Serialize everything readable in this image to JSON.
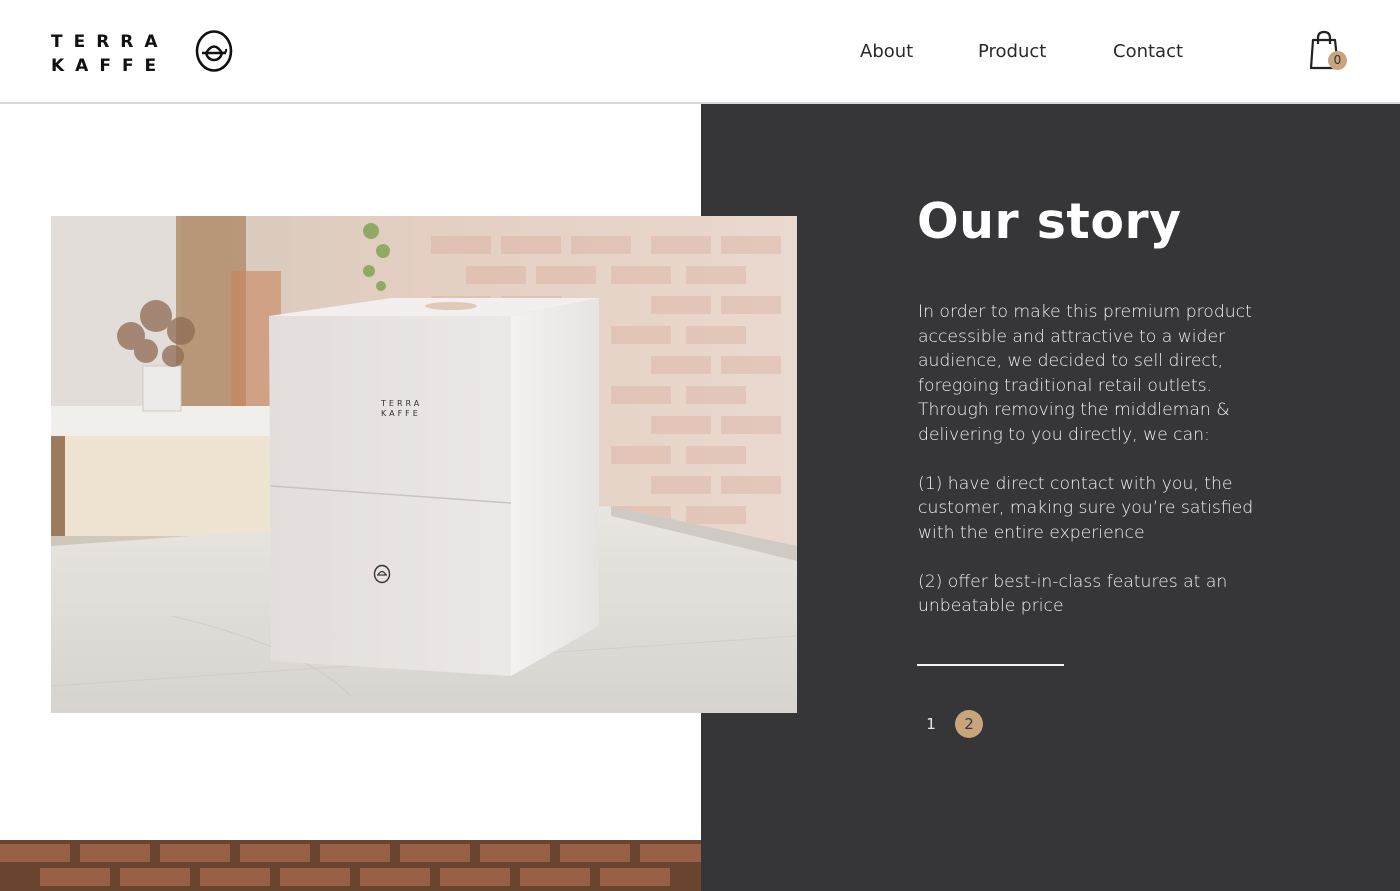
{
  "brand": {
    "line1": "TERRA",
    "line2": "KAFFE",
    "box_line1": "TERRA",
    "box_line2": "KAFFE"
  },
  "nav": {
    "items": [
      "About",
      "Product",
      "Contact"
    ]
  },
  "cart": {
    "count": "0"
  },
  "story": {
    "title": "Our story",
    "paragraphs": [
      "In order to make this premium product accessible and attractive to a wider audience, we decided to sell direct, foregoing traditional retail outlets. Through removing the middleman & delivering to you directly, we can:",
      "(1) have direct contact with you, the customer, making sure you’re satisfied with the entire experience",
      "(2) offer best-in-class features at an unbeatable price"
    ]
  },
  "pagination": {
    "pages": [
      "1",
      "2"
    ],
    "active": "2"
  },
  "colors": {
    "dark_panel": "#363537",
    "accent": "#c9a57d",
    "text_dark": "#2a2a2a",
    "text_light": "#ffffff"
  },
  "icons": {
    "logo": "terra-kaffe-logo-icon",
    "cart": "shopping-bag-icon"
  }
}
